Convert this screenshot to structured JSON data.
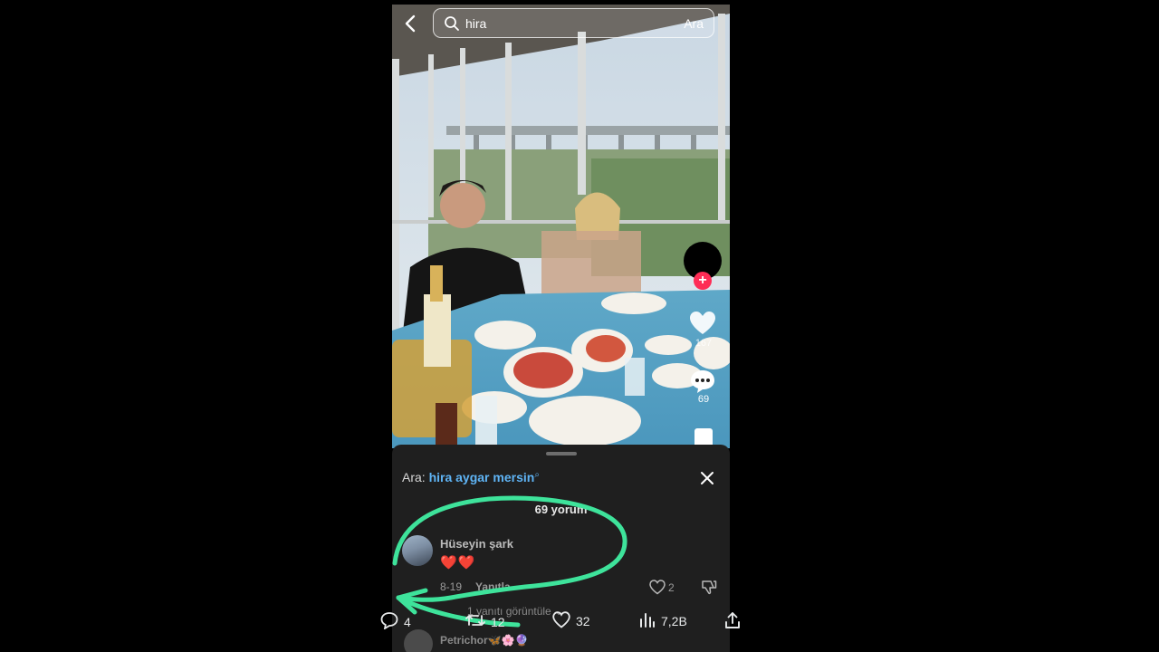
{
  "header": {
    "search_text": "hira",
    "search_button": "Ara"
  },
  "side_actions": {
    "like_count": "167",
    "comment_count": "69"
  },
  "comments_sheet": {
    "search_prefix": "Ara:",
    "search_query": "hira aygar mersin",
    "count_label": "69 yorum",
    "comment": {
      "user": "Hüseyin şark",
      "text": "❤️❤️",
      "date": "8-19",
      "reply_label": "Yanıtla",
      "like_count": "2"
    },
    "view_replies": "1 yanıtı görüntüle ⌄",
    "next_user": "Petrichor🦋🌸🔮"
  },
  "tweet_bar": {
    "replies": "4",
    "retweets": "12",
    "likes": "32",
    "views": "7,2B"
  },
  "colors": {
    "annotation": "#3ee39b",
    "link": "#5fb4f5",
    "follow_accent": "#fe2c55"
  }
}
